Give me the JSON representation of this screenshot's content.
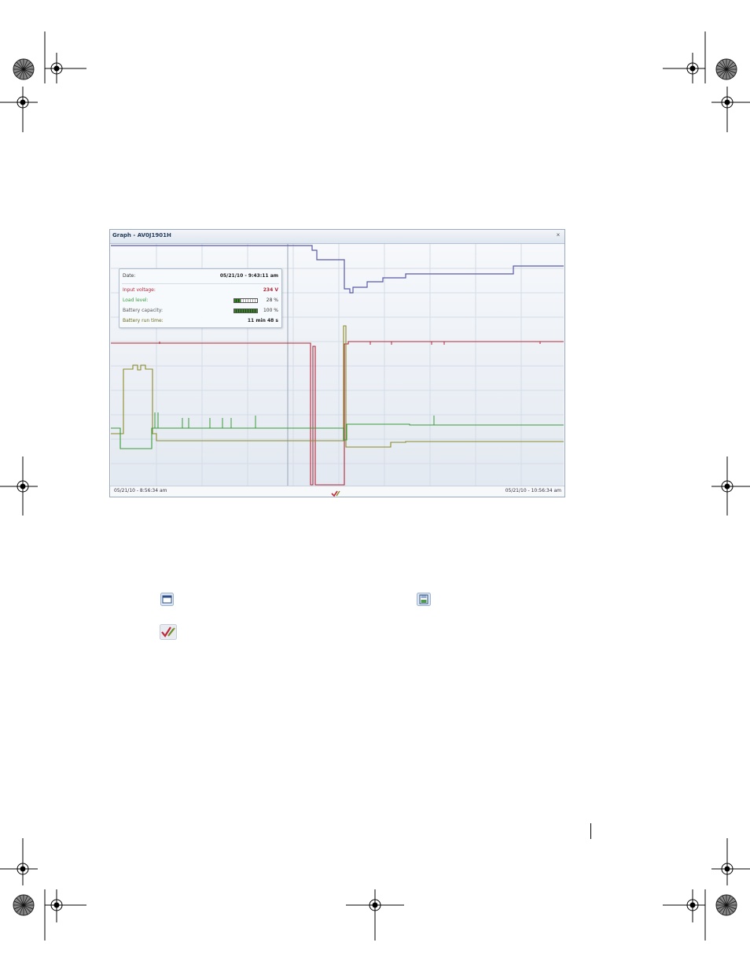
{
  "graph": {
    "title": "Graph - AV0J1901H",
    "close_label": "×",
    "footer_start": "05/21/10 - 8:56:34 am",
    "footer_end": "05/21/10 - 10:56:34 am"
  },
  "tooltip": {
    "date_label": "Date:",
    "date_value": "05/21/10 - 9:43:11 am",
    "input_voltage_label": "Input voltage:",
    "input_voltage_value": "234 V",
    "load_level_label": "Load level:",
    "load_level_value": "28 %",
    "load_level_fraction": 0.28,
    "battery_capacity_label": "Battery capacity:",
    "battery_capacity_value": "100 %",
    "battery_capacity_fraction": 1.0,
    "battery_runtime_label": "Battery run time:",
    "battery_runtime_value": "11 min 48 s"
  },
  "colors": {
    "input_voltage": "#b0283a",
    "load_level": "#3a9a3a",
    "battery_capacity": "#8a8a2a",
    "top_series": "#5a5aa8",
    "window_border": "#9aa9bc"
  },
  "icons": {
    "window": "window-icon",
    "save": "save-icon",
    "check": "check-edit-icon"
  }
}
